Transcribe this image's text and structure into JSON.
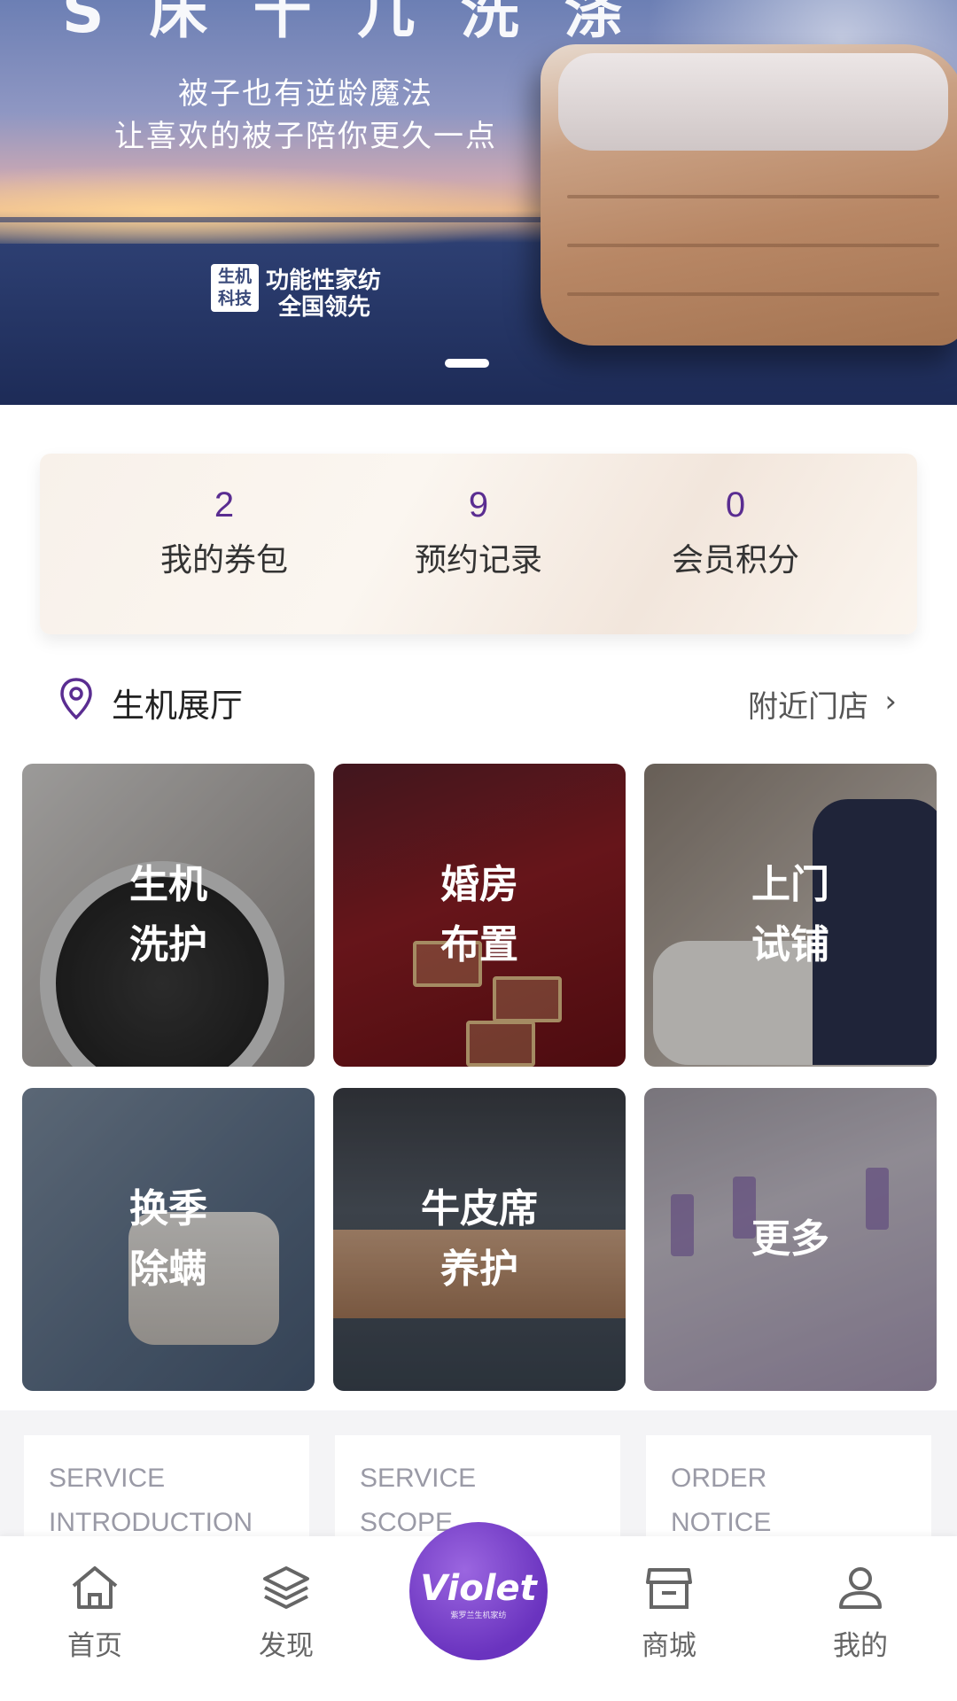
{
  "banner": {
    "headline": "S 床 十 几 洗 涤",
    "line1": "被子也有逆龄魔法",
    "line2": "让喜欢的被子陪你更久一点",
    "logo_text": "生机 科技",
    "tag1": "功能性家纺",
    "tag2": "全国领先"
  },
  "stats": [
    {
      "value": "2",
      "label": "我的券包"
    },
    {
      "value": "9",
      "label": "预约记录"
    },
    {
      "value": "0",
      "label": "会员积分"
    }
  ],
  "hall": {
    "name": "生机展厅",
    "nearby": "附近门店",
    "chevron": "›"
  },
  "services": [
    {
      "label": "生机\n洗护"
    },
    {
      "label": "婚房\n布置"
    },
    {
      "label": "上门\n试铺"
    },
    {
      "label": "换季\n除螨"
    },
    {
      "label": "牛皮席\n养护"
    },
    {
      "label": "更多"
    }
  ],
  "info_cards": [
    {
      "line1": "SERVICE",
      "line2": "INTRODUCTION"
    },
    {
      "line1": "SERVICE",
      "line2": "SCOPE"
    },
    {
      "line1": "ORDER",
      "line2": "NOTICE"
    }
  ],
  "nav": {
    "home": "首页",
    "discover": "发现",
    "center_brand": "Violet",
    "center_sub": "紫罗兰生机家纺",
    "mall": "商城",
    "mine": "我的"
  },
  "colors": {
    "accent": "#5a2d91",
    "nav_center": "#7a3fd0"
  }
}
